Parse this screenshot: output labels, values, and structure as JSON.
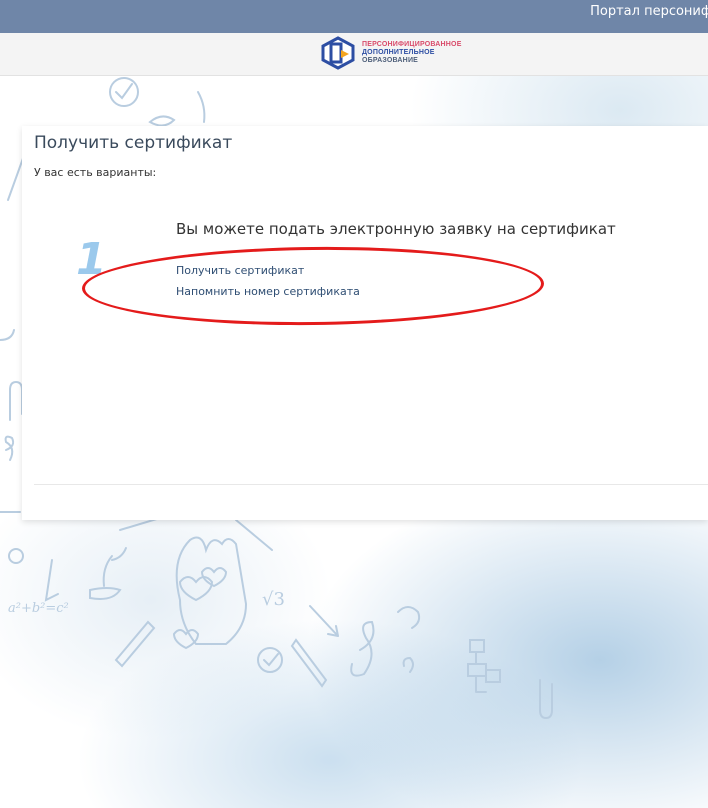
{
  "header": {
    "portal_link": "Портал персониф"
  },
  "logo": {
    "line1": "ПЕРСОНИФИЦИРОВАННОЕ",
    "line2": "ДОПОЛНИТЕЛЬНОЕ",
    "line3": "ОБРАЗОВАНИЕ"
  },
  "card": {
    "title": "Получить сертификат",
    "subtitle": "У вас есть варианты:",
    "option": {
      "number": "1",
      "heading": "Вы можете подать электронную заявку на сертификат",
      "links": [
        "Получить сертификат",
        "Напомнить номер сертификата"
      ]
    }
  },
  "doodle_text": {
    "formula": "a²+b²=c²",
    "root": "√3"
  },
  "colors": {
    "topbar": "#6f86a8",
    "annotation": "#e41b1b",
    "link": "#2f4e73",
    "accent_number": "#7ab7e6"
  }
}
